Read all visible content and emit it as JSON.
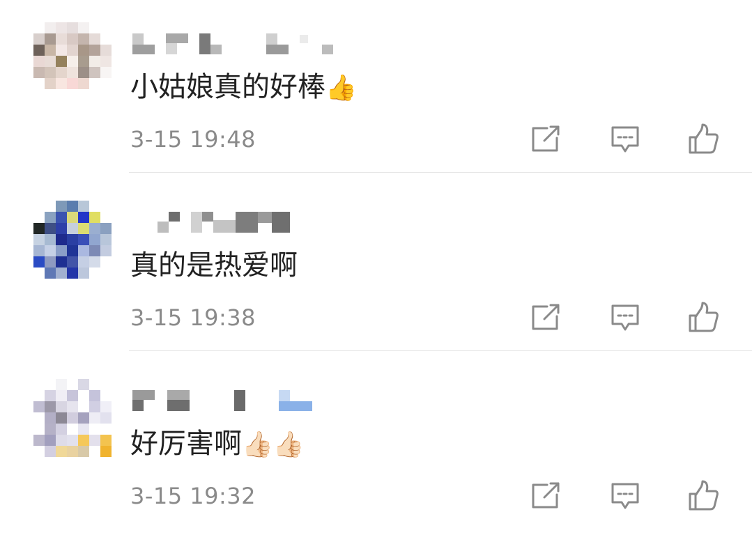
{
  "comments": [
    {
      "text": "小姑娘真的好棒",
      "emoji": "👍",
      "time": "3-15 19:48",
      "avatar_colors": [
        "#ffffff",
        "#f2eeee",
        "#ede5e5",
        "#e6dede",
        "#f4f1f1",
        "#ffffff",
        "#ffffff",
        "#d8cfcc",
        "#a89a91",
        "#e8dcd8",
        "#d8c9c4",
        "#c4b5ad",
        "#e5dbd8",
        "#ffffff",
        "#6e625a",
        "#c8b6a6",
        "#f3e8e6",
        "#e2d4cf",
        "#a89788",
        "#b3a39a",
        "#e6dcd9",
        "#e9d8d4",
        "#e8dcd6",
        "#94815c",
        "#f6efea",
        "#a89c8e",
        "#f2ede8",
        "#efe6e3",
        "#c9b9b1",
        "#d3c4b9",
        "#e4d5cc",
        "#efe3dd",
        "#9c8f87",
        "#cfc4bf",
        "#f8f5f4",
        "#ffffff",
        "#e3d2c8",
        "#f8e6e0",
        "#f8d8d6",
        "#eed8d0",
        "#ffffff",
        "#ffffff",
        "#ffffff",
        "#ffffff",
        "#ffffff",
        "#ffffff",
        "#ffffff",
        "#ffffff",
        "#ffffff"
      ],
      "username_color": "#8a8a8a"
    },
    {
      "text": "真的是热爱啊",
      "emoji": "",
      "time": "3-15 19:38",
      "avatar_colors": [
        "#ffffff",
        "#ffffff",
        "#7e99b8",
        "#5b7dae",
        "#b8c7d8",
        "#ffffff",
        "#ffffff",
        "#ffffff",
        "#8aa2c0",
        "#3a53b0",
        "#dad97a",
        "#2335c8",
        "#e0de62",
        "#ffffff",
        "#222826",
        "#3e4f85",
        "#2d3fa8",
        "#c5cfdd",
        "#dcdc72",
        "#9aaed0",
        "#8aa0c0",
        "#c6d2e2",
        "#a7bad2",
        "#1e2a8c",
        "#2a3fa3",
        "#3a4fb8",
        "#91a6cf",
        "#b8c6da",
        "#a6b6d3",
        "#c5d0e6",
        "#8a9ec8",
        "#1f3496",
        "#aab8e0",
        "#7d8ab5",
        "#c3cce0",
        "#2a4bc4",
        "#8e9ac1",
        "#1e2f92",
        "#4254a8",
        "#c5cfe4",
        "#d4dbe9",
        "#ffffff",
        "#ffffff",
        "#5f78b5",
        "#a1b0d0",
        "#2335a8",
        "#bcc7dc",
        "#ffffff",
        "#ffffff"
      ],
      "username_color": "#8a8a8a"
    },
    {
      "text": "好厉害啊",
      "emoji": "👍🏻👍🏻",
      "time": "3-15 19:32",
      "avatar_colors": [
        "#ffffff",
        "#ffffff",
        "#f3f3f6",
        "#ffffff",
        "#d9d8e5",
        "#ffffff",
        "#ffffff",
        "#ffffff",
        "#d6d3e3",
        "#f0eef5",
        "#c7c4da",
        "#ffffff",
        "#c5c3db",
        "#ffffff",
        "#c0bdd2",
        "#9c98a8",
        "#d8d5e2",
        "#e6e4ee",
        "#ffffff",
        "#d1cfe3",
        "#f0eff7",
        "#ffffff",
        "#b3afc6",
        "#8c8895",
        "#d1cdde",
        "#a5a2be",
        "#eeedf5",
        "#e2e1ee",
        "#ffffff",
        "#b5b1c7",
        "#d3d0e1",
        "#ffffff",
        "#e8e7f2",
        "#ffffff",
        "#ffffff",
        "#bcb8cc",
        "#a29fbe",
        "#dedce9",
        "#e2e1ee",
        "#f5c85a",
        "#e3e0ec",
        "#f3c34f",
        "#ffffff",
        "#d3cfe1",
        "#f0d898",
        "#e9d2a0",
        "#d8c9a8",
        "#ffffff",
        "#f0b32e"
      ],
      "username_color": "#8a8a8a"
    }
  ],
  "icons": {
    "share": "share-icon",
    "reply": "comment-icon",
    "like": "thumbs-up-icon"
  },
  "colors": {
    "text": "#222222",
    "secondary": "#8a8a8a",
    "icon": "#8a8a8a",
    "divider": "#e6e6e6"
  }
}
